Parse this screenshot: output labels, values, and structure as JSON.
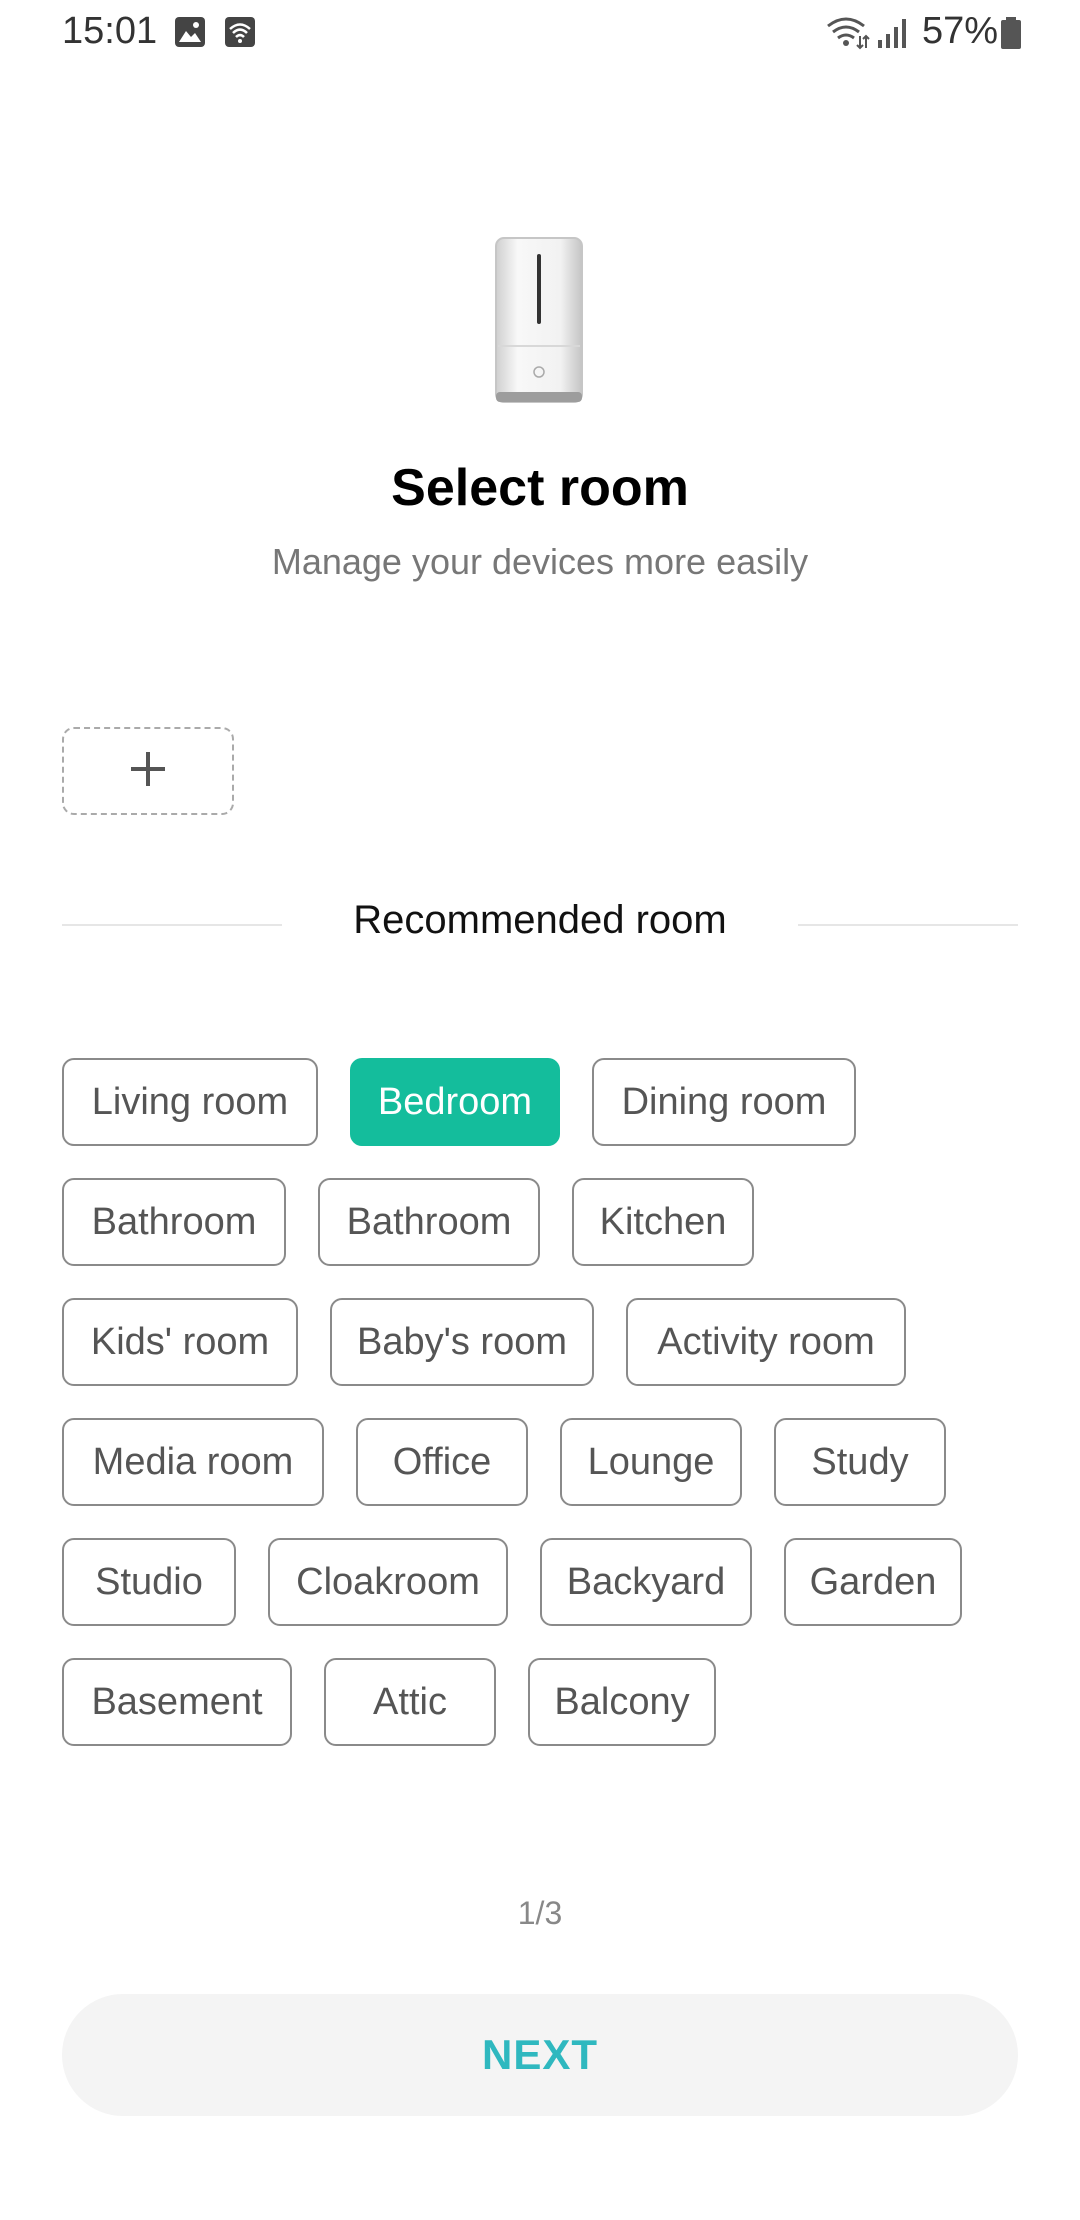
{
  "status_bar": {
    "time": "15:01",
    "battery": "57%",
    "icons": [
      "image-icon",
      "wifi-calling-icon",
      "wifi-icon",
      "signal-icon",
      "battery-icon"
    ]
  },
  "header": {
    "device_icon": "humidifier-device-icon",
    "title": "Select room",
    "subtitle": "Manage your devices more easily"
  },
  "add_room": {
    "icon": "plus-icon"
  },
  "recommended": {
    "label": "Recommended room",
    "rooms": [
      {
        "label": "Living room",
        "selected": false
      },
      {
        "label": "Bedroom",
        "selected": true
      },
      {
        "label": "Dining room",
        "selected": false
      },
      {
        "label": "Bathroom",
        "selected": false
      },
      {
        "label": "Bathroom",
        "selected": false
      },
      {
        "label": "Kitchen",
        "selected": false
      },
      {
        "label": "Kids' room",
        "selected": false
      },
      {
        "label": "Baby's room",
        "selected": false
      },
      {
        "label": "Activity room",
        "selected": false
      },
      {
        "label": "Media room",
        "selected": false
      },
      {
        "label": "Office",
        "selected": false
      },
      {
        "label": "Lounge",
        "selected": false
      },
      {
        "label": "Study",
        "selected": false
      },
      {
        "label": "Studio",
        "selected": false
      },
      {
        "label": "Cloakroom",
        "selected": false
      },
      {
        "label": "Backyard",
        "selected": false
      },
      {
        "label": "Garden",
        "selected": false
      },
      {
        "label": "Basement",
        "selected": false
      },
      {
        "label": "Attic",
        "selected": false
      },
      {
        "label": "Balcony",
        "selected": false
      }
    ]
  },
  "pager": "1/3",
  "next_button": {
    "label": "NEXT"
  },
  "colors": {
    "accent": "#14bd9c",
    "next_text": "#2fb8bf"
  }
}
